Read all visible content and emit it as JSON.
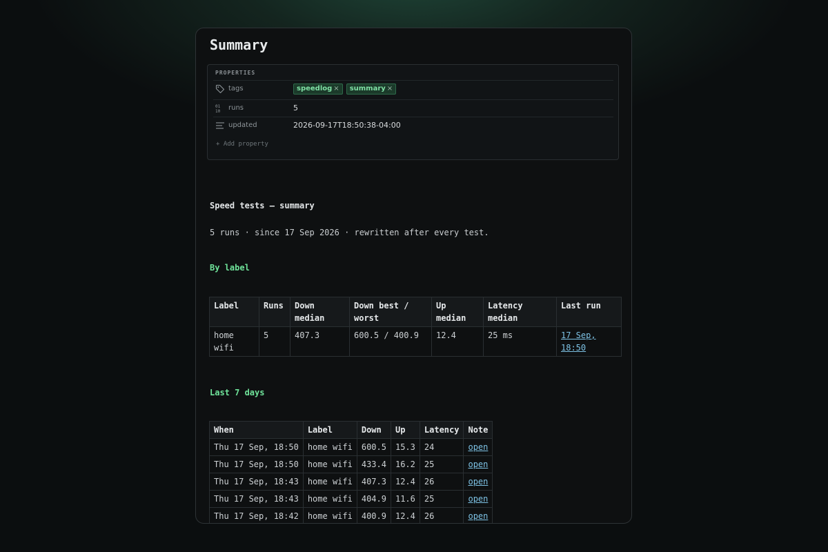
{
  "page": {
    "title": "Summary"
  },
  "properties": {
    "heading": "PROPERTIES",
    "tags": {
      "key": "tags",
      "items": [
        {
          "label": "speedlog",
          "remove": "×"
        },
        {
          "label": "summary",
          "remove": "×"
        }
      ]
    },
    "runs": {
      "key": "runs",
      "value": "5"
    },
    "updated": {
      "key": "updated",
      "value": "2026-09-17T18:50:38-04:00"
    },
    "add_property": "+ Add property"
  },
  "content": {
    "heading": "Speed tests — summary",
    "summary_line": "5 runs · since 17 Sep 2026 · rewritten after every test."
  },
  "by_label": {
    "heading": "By label",
    "columns": [
      "Label",
      "Runs",
      "Down median",
      "Down best / worst",
      "Up median",
      "Latency median",
      "Last run"
    ],
    "rows": [
      {
        "label": "home wifi",
        "runs": "5",
        "down_median": "407.3",
        "down_best_worst": "600.5 / 400.9",
        "up_median": "12.4",
        "latency_median": "25 ms",
        "last_run": "17 Sep, 18:50"
      }
    ]
  },
  "last_7_days": {
    "heading": "Last 7 days",
    "columns": [
      "When",
      "Label",
      "Down",
      "Up",
      "Latency",
      "Note"
    ],
    "rows": [
      {
        "when": "Thu 17 Sep, 18:50",
        "label": "home wifi",
        "down": "600.5",
        "up": "15.3",
        "latency": "24",
        "note": "open"
      },
      {
        "when": "Thu 17 Sep, 18:50",
        "label": "home wifi",
        "down": "433.4",
        "up": "16.2",
        "latency": "25",
        "note": "open"
      },
      {
        "when": "Thu 17 Sep, 18:43",
        "label": "home wifi",
        "down": "407.3",
        "up": "12.4",
        "latency": "26",
        "note": "open"
      },
      {
        "when": "Thu 17 Sep, 18:43",
        "label": "home wifi",
        "down": "404.9",
        "up": "11.6",
        "latency": "25",
        "note": "open"
      },
      {
        "when": "Thu 17 Sep, 18:42",
        "label": "home wifi",
        "down": "400.9",
        "up": "12.4",
        "latency": "26",
        "note": "open"
      }
    ]
  },
  "colors": {
    "accent_green": "#6fe39a",
    "link": "#7ec3e6",
    "tag_bg": "#1b3a2a"
  },
  "icons": {
    "tags": "tag-icon",
    "runs": "number-icon",
    "updated": "text-lines-icon"
  }
}
